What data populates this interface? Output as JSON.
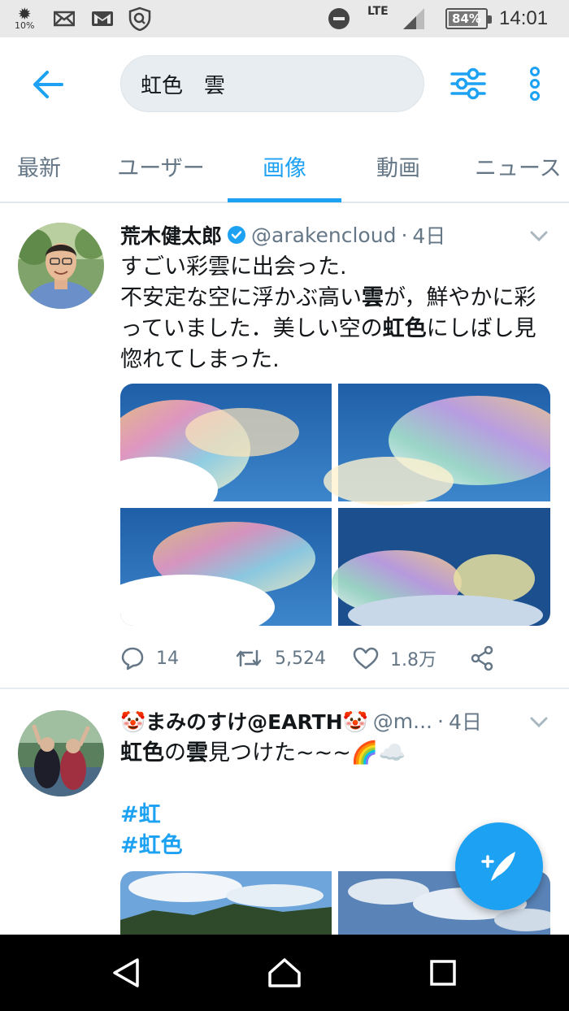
{
  "status_bar": {
    "brightness_percent": "10%",
    "battery": "84%",
    "network": "LTE",
    "time": "14:01",
    "icons": [
      "brightness-icon",
      "mail-icon",
      "gmail-icon",
      "vpn-shield-icon",
      "do-not-disturb-icon",
      "signal-icon",
      "battery-icon"
    ]
  },
  "header": {
    "back_icon": "arrow-left-icon",
    "search_value": "虹色　雲",
    "filter_icon": "sliders-icon",
    "more_icon": "more-vertical-icon"
  },
  "tabs": {
    "items": [
      {
        "label": "最新"
      },
      {
        "label": "ユーザー"
      },
      {
        "label": "画像"
      },
      {
        "label": "動画"
      },
      {
        "label": "ニュース"
      }
    ],
    "active": "画像"
  },
  "tweets": [
    {
      "name": "荒木健太郎",
      "verified": true,
      "handle": "@arakencloud",
      "separator": "·",
      "time": "4日",
      "text_parts": {
        "p1": "すごい彩雲に出会った.\n不安定な空に浮かぶ高い",
        "p2": "雲",
        "p3": "が，鮮やかに彩っていました．美しい空の",
        "p4": "虹色",
        "p5": "にしばし見惚れてしまった."
      },
      "media_count": 4,
      "actions": {
        "reply_count": "14",
        "retweet_count": "5,524",
        "like_count": "1.8万"
      }
    },
    {
      "name": "🤡まみのすけ@EARTH🤡",
      "handle": "@m...",
      "separator": "·",
      "time": "4日",
      "text_parts": {
        "p1": "虹色",
        "p2": "の",
        "p3": "雲",
        "p4": "見つけた~~~🌈☁️"
      },
      "hashtags": [
        "#虹",
        "#虹色"
      ],
      "media_count": 2
    }
  ],
  "fab": {
    "icon": "compose-tweet-icon"
  },
  "nav": {
    "icons": [
      "back-triangle-icon",
      "home-icon",
      "recents-icon"
    ]
  },
  "colors": {
    "accent": "#1da1f2",
    "text": "#14171a",
    "muted": "#657786"
  }
}
